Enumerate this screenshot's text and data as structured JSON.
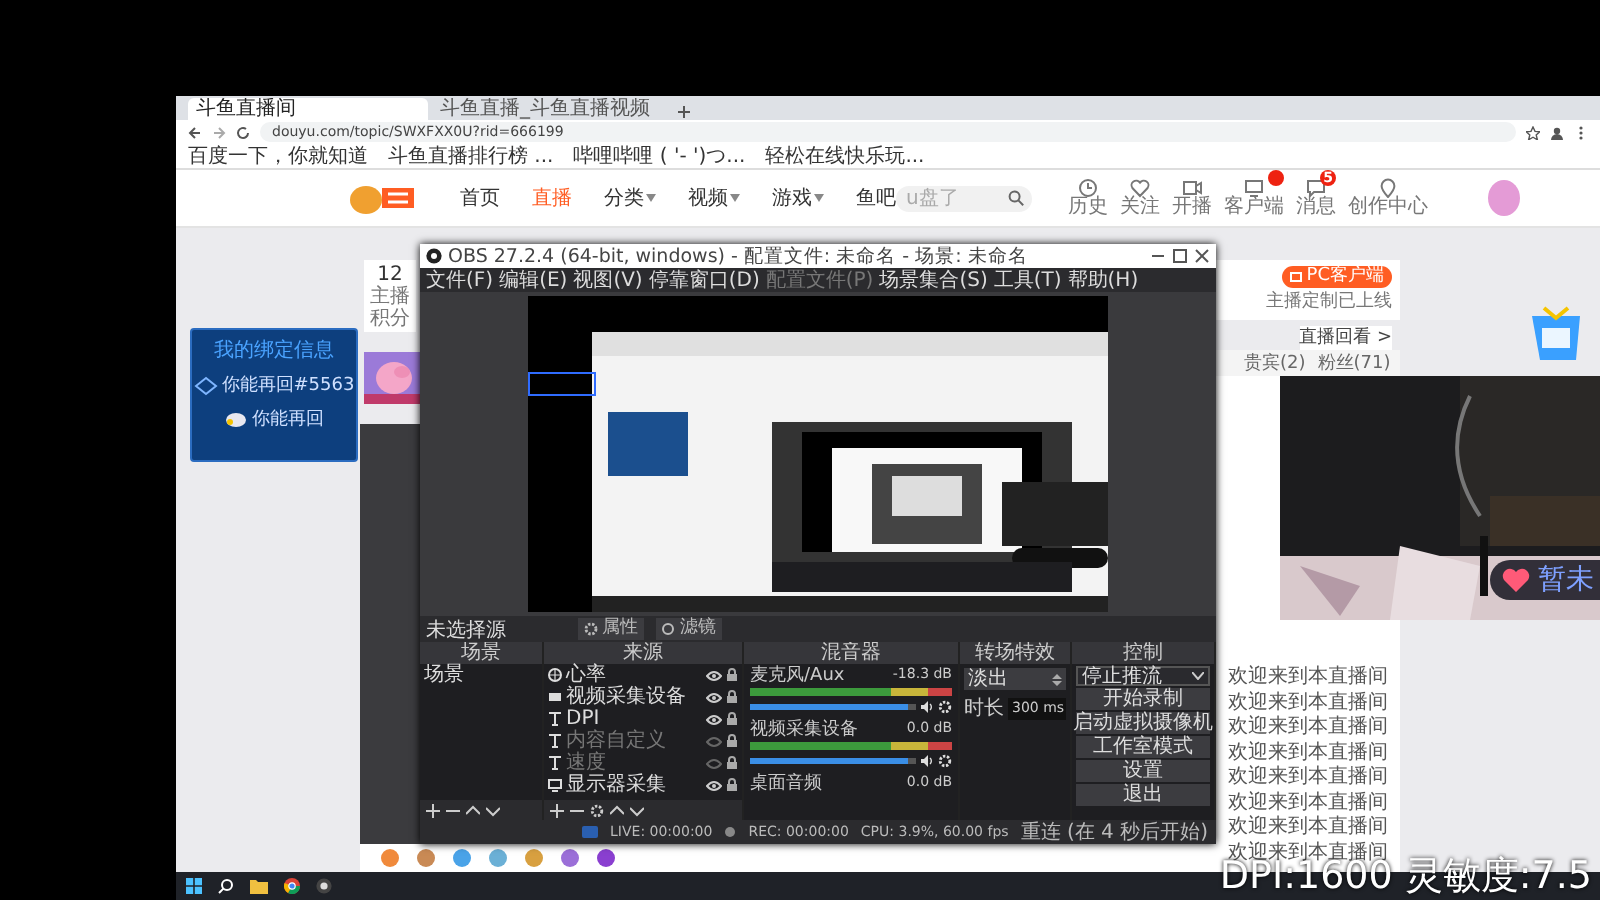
{
  "browser": {
    "tabs": [
      {
        "title": "斗鱼直播间",
        "selected": true
      },
      {
        "title": "斗鱼直播_斗鱼直播视频",
        "selected": false
      }
    ],
    "address": "douyu.com/topic/SWXFXX0U?rid=666199",
    "bookmarks": [
      "百度一下，你就知道",
      "斗鱼直播排行榜 ...",
      "哔哩哔哩 ( '- ')つ...",
      "轻松在线快乐玩..."
    ]
  },
  "site_header": {
    "nav": [
      {
        "label": "首页",
        "selected": false,
        "dropdown": false
      },
      {
        "label": "直播",
        "selected": true,
        "dropdown": false
      },
      {
        "label": "分类",
        "selected": false,
        "dropdown": true
      },
      {
        "label": "视频",
        "selected": false,
        "dropdown": true
      },
      {
        "label": "游戏",
        "selected": false,
        "dropdown": true
      },
      {
        "label": "鱼吧",
        "selected": false,
        "dropdown": false
      }
    ],
    "search": {
      "placeholder": "u盘了"
    },
    "actions": [
      {
        "label": "历史",
        "badge": false
      },
      {
        "label": "关注",
        "badge": false
      },
      {
        "label": "开播",
        "badge": false
      },
      {
        "label": "客户端",
        "badge": true
      },
      {
        "label": "消息",
        "badge": true,
        "count": "5"
      },
      {
        "label": "创作中心",
        "badge": false
      }
    ]
  },
  "bind_card": {
    "title": "我的绑定信息",
    "lines": [
      "你能再回#5563",
      "你能再回"
    ]
  },
  "score": {
    "value": "12",
    "label": "主播积分"
  },
  "side_panel": {
    "client_button": "PC客户端",
    "client_note": "主播定制已上线",
    "replay_link": "直播回看 >",
    "tabs": [
      {
        "label": "贵宾(2)",
        "selected": false
      },
      {
        "label": "粉丝(71)",
        "selected": false
      }
    ],
    "chat": [
      "欢迎来到本直播间",
      "欢迎来到本直播间",
      "欢迎来到本直播间",
      "欢迎来到本直播间",
      "欢迎来到本直播间",
      "欢迎来到本直播间",
      "欢迎来到本直播间",
      "欢迎来到本直播间"
    ]
  },
  "cam_badge": "暂未",
  "obs": {
    "title": "OBS 27.2.4 (64-bit, windows) - 配置文件: 未命名 - 场景: 未命名",
    "menu": [
      {
        "label": "文件(F)",
        "disabled": false
      },
      {
        "label": "编辑(E)",
        "disabled": false
      },
      {
        "label": "视图(V)",
        "disabled": false
      },
      {
        "label": "停靠窗口(D)",
        "disabled": false
      },
      {
        "label": "配置文件(P)",
        "disabled": true
      },
      {
        "label": "场景集合(S)",
        "disabled": false
      },
      {
        "label": "工具(T)",
        "disabled": false
      },
      {
        "label": "帮助(H)",
        "disabled": false
      }
    ],
    "source_bar": {
      "label": "未选择源",
      "buttons": [
        "属性",
        "滤镜"
      ]
    },
    "docks": {
      "scenes": "场景",
      "sources": "来源",
      "mixer": "混音器",
      "transitions": "转场特效",
      "controls": "控制"
    },
    "scenes": [
      "场景"
    ],
    "sources": [
      {
        "name": "心率",
        "kind": "browser",
        "visible": true
      },
      {
        "name": "视频采集设备",
        "kind": "camera",
        "visible": true
      },
      {
        "name": "DPI",
        "kind": "text",
        "visible": true
      },
      {
        "name": "内容自定义",
        "kind": "text",
        "visible": false
      },
      {
        "name": "速度",
        "kind": "text",
        "visible": false
      },
      {
        "name": "显示器采集",
        "kind": "display",
        "visible": true
      }
    ],
    "mixer": [
      {
        "name": "麦克风/Aux",
        "reading": "-18.3 dB",
        "level": 0.95
      },
      {
        "name": "视频采集设备",
        "reading": "0.0 dB",
        "level": 0.95
      },
      {
        "name": "桌面音频",
        "reading": "0.0 dB"
      }
    ],
    "transition": {
      "value": "淡出",
      "duration_label": "时长",
      "duration": "300 ms"
    },
    "controls": [
      {
        "label": "停止推流",
        "kind": "select"
      },
      {
        "label": "开始录制",
        "kind": "button"
      },
      {
        "label": "启动虚拟摄像机",
        "kind": "button"
      },
      {
        "label": "工作室模式",
        "kind": "button"
      },
      {
        "label": "设置",
        "kind": "button"
      },
      {
        "label": "退出",
        "kind": "button"
      }
    ],
    "status": {
      "live": "LIVE: 00:00:00",
      "rec": "REC: 00:00:00",
      "cpu": "CPU: 3.9%, 60.00 fps",
      "reconnect": "重连 (在 4 秒后开始)"
    }
  },
  "overlay": "DPI:1600 灵敏度:7.5"
}
